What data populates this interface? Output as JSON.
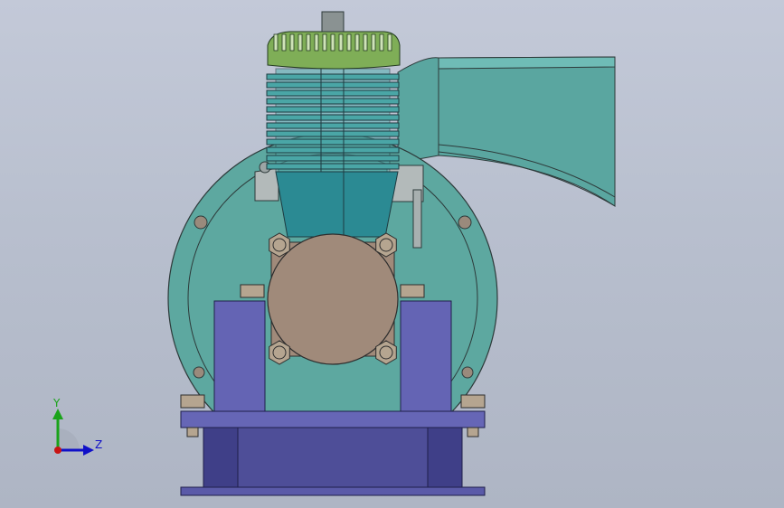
{
  "triad": {
    "y_label": "Y",
    "z_label": "Z",
    "colors": {
      "y": "#1aa31a",
      "z": "#1010c8",
      "x": "#c81414"
    }
  },
  "model_colors": {
    "housing": "#5da8a0",
    "housing_dark": "#3f7f79",
    "cylinder": "#4aa6a6",
    "cylinder_dark": "#2b7f86",
    "head": "#7fae57",
    "crankcase_cover": "#a08a7a",
    "bracket": "#6464b4",
    "base": "#4e4e98",
    "bolt": "#b5a590",
    "pipe": "#aeb6b6"
  }
}
